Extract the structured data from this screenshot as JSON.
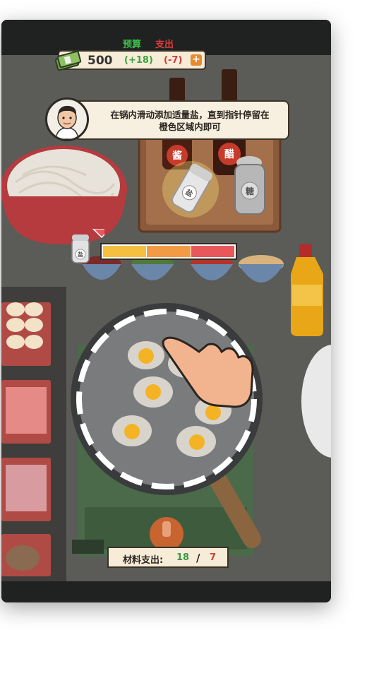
{
  "hud": {
    "budget_label": "预算",
    "expense_label": "支出",
    "money": "500",
    "income_delta": "(+18)",
    "expense_delta": "(-7)",
    "add_symbol": "+"
  },
  "hint": {
    "text": "在锅内滑动添加适量盐，直到指针停留在橙色区域内即可"
  },
  "condiments": {
    "soy_label": "酱",
    "vinegar_label": "醋",
    "salt_label": "盐",
    "sugar_label": "糖",
    "meter_salt_label": "盐"
  },
  "salt_meter": {
    "level": 0.0,
    "zones": [
      "yellow",
      "orange",
      "red"
    ],
    "colors": {
      "yellow": "#f5c03f",
      "orange": "#f39a45",
      "red": "#e8585a"
    }
  },
  "cost": {
    "label": "材料支出:",
    "income": "18",
    "separator": "/",
    "expense": "7"
  },
  "icons": [
    "money-stack-icon",
    "plus-icon",
    "chef-avatar",
    "salt-shaker-icon",
    "sugar-shaker-icon",
    "hand-pointer-icon",
    "pointer-triangle-icon"
  ],
  "colors": {
    "green": "#3cc24a",
    "red": "#e03a3a",
    "panel": "#f6ecd8",
    "border": "#3b3226"
  }
}
